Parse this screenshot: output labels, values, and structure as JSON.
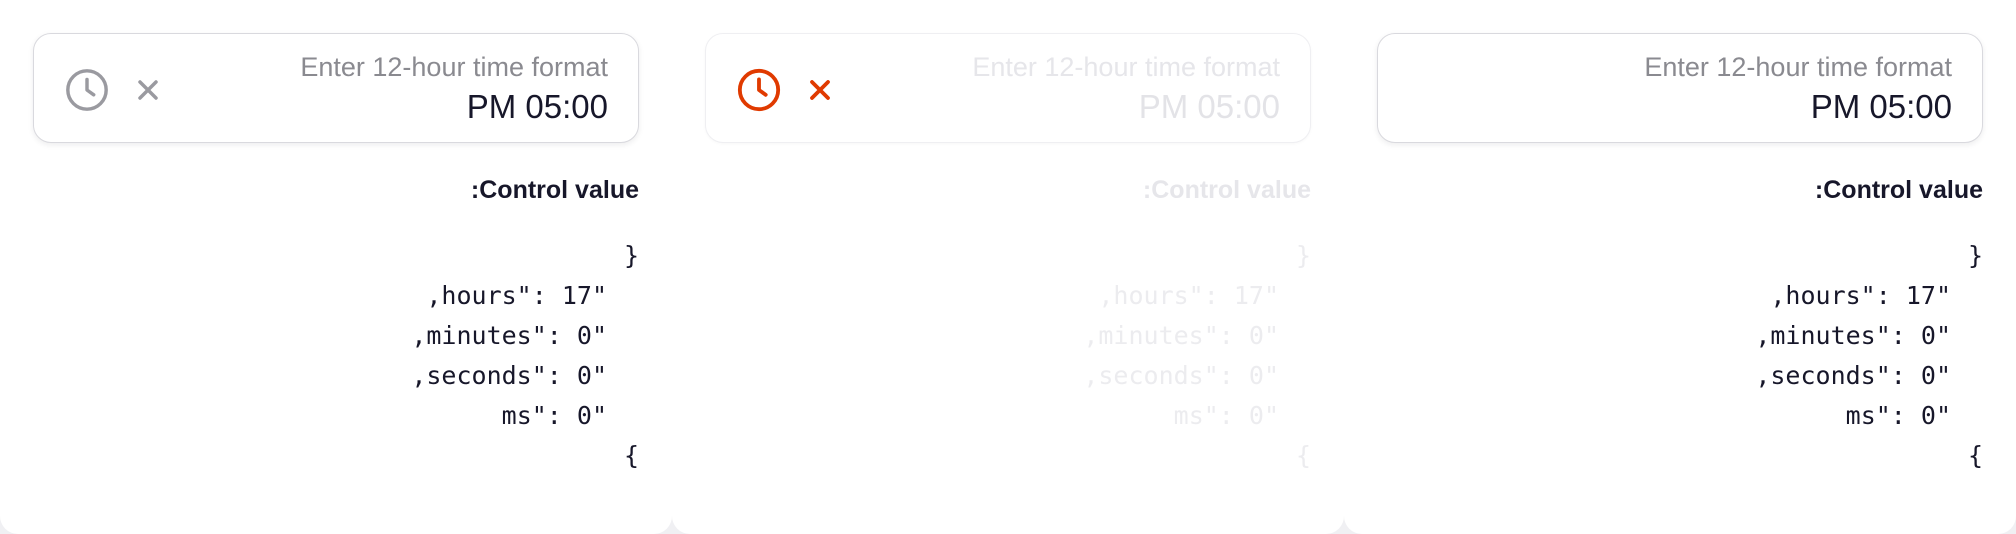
{
  "colors": {
    "accent_error": "#e03a00",
    "text_primary": "#17172a",
    "text_muted": "#8a8a90",
    "border": "#d9d9de",
    "icon_gray": "#9a9aa0"
  },
  "panels": [
    {
      "state": "default",
      "placeholder": "Enter 12-hour time format",
      "value": "PM 05:00",
      "icons": [
        "clock-icon",
        "close-icon"
      ],
      "control_label": ":Control value",
      "code": {
        "open": "}",
        "hours": ",hours\": 17\"",
        "minutes": ",minutes\": 0\"",
        "seconds": ",seconds\": 0\"",
        "ms": "ms\": 0\"",
        "close": "{"
      }
    },
    {
      "state": "disabled-error",
      "placeholder": "Enter 12-hour time format",
      "value": "PM 05:00",
      "icons": [
        "clock-icon",
        "close-icon"
      ],
      "control_label": ":Control value",
      "code": {
        "open": "}",
        "hours": ",hours\": 17\"",
        "minutes": ",minutes\": 0\"",
        "seconds": ",seconds\": 0\"",
        "ms": "ms\": 0\"",
        "close": "{"
      }
    },
    {
      "state": "no-icons",
      "placeholder": "Enter 12-hour time format",
      "value": "PM 05:00",
      "icons": [],
      "control_label": ":Control value",
      "code": {
        "open": "}",
        "hours": ",hours\": 17\"",
        "minutes": ",minutes\": 0\"",
        "seconds": ",seconds\": 0\"",
        "ms": "ms\": 0\"",
        "close": "{"
      }
    }
  ]
}
